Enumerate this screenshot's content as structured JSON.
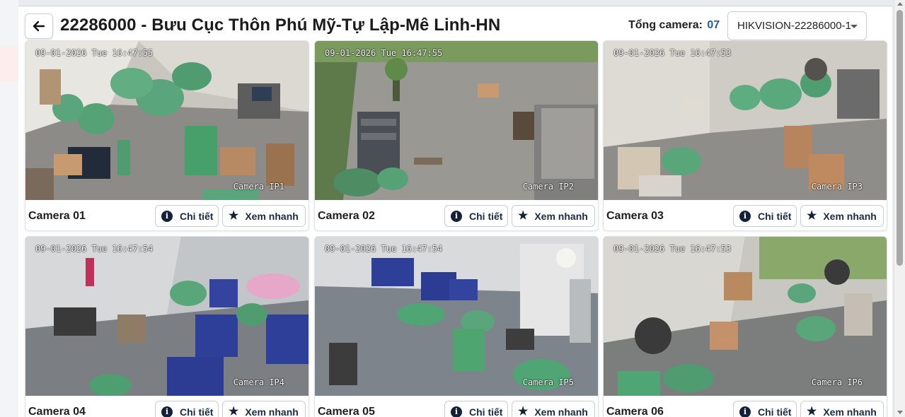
{
  "header": {
    "title": "22286000 - Bưu Cục Thôn Phú Mỹ-Tự Lập-Mê Linh-HN",
    "camera_count_label": "Tổng camera:",
    "camera_count": "07",
    "selected_camera": "HIKVISION-22286000-1"
  },
  "buttons": {
    "detail": "Chi tiết",
    "quick_view": "Xem nhanh"
  },
  "icons": {
    "back": "arrow-left-icon",
    "detail": "info-circle-icon",
    "quick_view": "star-icon",
    "select": "chevron-down-icon"
  },
  "cameras": [
    {
      "name": "Camera 01",
      "timestamp": "09-01-2026 Tue 16:47:55",
      "overlay": "Camera IP1"
    },
    {
      "name": "Camera 02",
      "timestamp": "09-01-2026 Tue 16:47:55",
      "overlay": "Camera IP2"
    },
    {
      "name": "Camera 03",
      "timestamp": "09-01-2026 Tue 16:47:53",
      "overlay": "Camera IP3"
    },
    {
      "name": "Camera 04",
      "timestamp": "09-01-2026 Tue 16:47:54",
      "overlay": "Camera IP4"
    },
    {
      "name": "Camera 05",
      "timestamp": "09-01-2026 Tue 16:47:54",
      "overlay": "Camera IP5"
    },
    {
      "name": "Camera 06",
      "timestamp": "09-01-2026 Tue 16:47:53",
      "overlay": "Camera IP6"
    }
  ],
  "colors": {
    "accent": "#1f5f9a",
    "button_text": "#1a2a44",
    "icon_dark": "#13213b",
    "bag_green": "#4a9b6e"
  }
}
